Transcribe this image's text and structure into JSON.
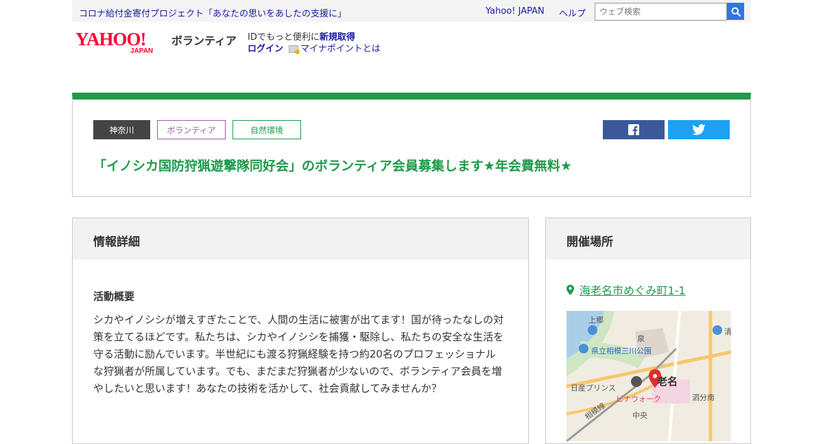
{
  "topbar": {
    "promo": "コロナ給付金寄付プロジェクト「あなたの思いをあしたの支援に」",
    "yahoo_link": "Yahoo! JAPAN",
    "help_link": "ヘルプ",
    "search_placeholder": "ウェブ検索"
  },
  "header": {
    "logo_text": "YAHOO!",
    "logo_sub": "JAPAN",
    "service_name": "ボランティア",
    "id_prefix": "IDでもっと便利に",
    "signup": "新規取得",
    "login": "ログイン",
    "mynapoint": "マイナポイントとは"
  },
  "article": {
    "tags": {
      "prefecture": "神奈川",
      "category": "ボランティア",
      "field": "自然環境"
    },
    "title": "「イノシカ国防狩猟遊撃隊同好会」のボランティア会員募集します★年会費無料★"
  },
  "detail": {
    "heading": "情報詳細",
    "section_title": "活動概要",
    "summary": "シカやイノシシが増えすぎたことで、人間の生活に被害が出てます！国が待ったなしの対策を立てるほどです。私たちは、シカやイノシシを捕獲・駆除し、私たちの安全な生活を守る活動に励んでいます。半世紀にも渡る狩猟経験を持つ約20名のプロフェッショナルな狩猟者が所属しています。でも、まだまだ狩猟者が少ないので、ボランティア会員を増やしたいと思います！あなたの技術を活かして、社会貢献してみませんか？"
  },
  "venue": {
    "heading": "開催場所",
    "address": "海老名市めぐみ町1-1",
    "map_labels": {
      "kamigou": "上郷",
      "izumi": "泉",
      "park": "県立相模三川公園",
      "prince": "日産プリンス",
      "ebina": "老名",
      "vinawalk": "ビナウォーク",
      "sagami_line": "相模線",
      "chuo": "中央",
      "imaizumi": "泗分南",
      "sei": "清"
    }
  },
  "colors": {
    "brand_green": "#1e9a4a",
    "link_blue": "#1a1aa6",
    "facebook": "#3b5998",
    "twitter": "#1da1f2",
    "yahoo_red": "#ff0033"
  },
  "icons": {
    "search": "search-icon",
    "facebook": "facebook-icon",
    "twitter": "twitter-icon",
    "pin": "map-pin-icon",
    "mynapoint": "mynapoint-icon"
  }
}
